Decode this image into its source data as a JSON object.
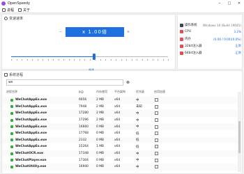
{
  "app": {
    "title": "OpenSpeedy"
  },
  "titlebar": {
    "minimize": "−",
    "maximize": "□",
    "close": "✕"
  },
  "menu": {
    "items": [
      "进程",
      "关于"
    ]
  },
  "speed": {
    "section_title": "变速速率",
    "display": "x 1.00倍",
    "minus": "−",
    "plus": "+",
    "value_label": "原速",
    "current": 1.0,
    "slider_fraction": 0.53
  },
  "hotkeys": [
    {
      "prefix": "Ctrl+Alt+",
      "key": "↑",
      "label": "增加速度"
    },
    {
      "prefix": "Ctrl+Alt+",
      "key": "↓",
      "label": "减少速度"
    },
    {
      "prefix": "Ctrl+Alt+",
      "key": "0",
      "label": "重置速度"
    }
  ],
  "system": {
    "rows": [
      {
        "label": "操作系统",
        "value": "Windows 10 (Build 19045)",
        "icon_color": "#444444"
      },
      {
        "label": "CPU",
        "value": "3.2%",
        "icon_color": "#e05050"
      },
      {
        "label": "内存",
        "value": "(0.00 / 0.00)(0.0%)",
        "icon_color": "#e05050"
      },
      {
        "label": "32bit注入器",
        "value": "正常",
        "icon_color": "#e05050"
      },
      {
        "label": "64bit注入器",
        "value": "正常",
        "icon_color": "#e05050"
      }
    ]
  },
  "process": {
    "section_title": "系统进程",
    "search_value": "we",
    "clear": "⊗",
    "columns": [
      "进程名称",
      "PID",
      "内存使用",
      "平台架构",
      "优先级",
      "启用加速"
    ],
    "rows": [
      {
        "name": "WeChatAppEx.exe",
        "pid": "6656",
        "mem": "2 MB",
        "arch": "x64",
        "priority": "中",
        "enabled": false
      },
      {
        "name": "WeChatAppEx.exe",
        "pid": "7948",
        "mem": "2 MB",
        "arch": "x64",
        "priority": "未知",
        "enabled": false
      },
      {
        "name": "WeChatAppEx.exe",
        "pid": "17280",
        "mem": "2 MB",
        "arch": "x64",
        "priority": "中",
        "enabled": false
      },
      {
        "name": "WeChatAppEx.exe",
        "pid": "17296",
        "mem": "2 MB",
        "arch": "x64",
        "priority": "中",
        "enabled": false
      },
      {
        "name": "WeChatAppEx.exe",
        "pid": "16660",
        "mem": "0 MB",
        "arch": "x64",
        "priority": "中",
        "enabled": false
      },
      {
        "name": "WeChatAppEx.exe",
        "pid": "17768",
        "mem": "0 MB",
        "arch": "x64",
        "priority": "低",
        "enabled": false
      },
      {
        "name": "WeChatAppEx.exe",
        "pid": "2332",
        "mem": "0 MB",
        "arch": "x64",
        "priority": "低",
        "enabled": false
      },
      {
        "name": "WeChatAppEx.exe",
        "pid": "15264",
        "mem": "1 MB",
        "arch": "x64",
        "priority": "低",
        "enabled": false
      },
      {
        "name": "WeChatOCR.exe",
        "pid": "17348",
        "mem": "0 MB",
        "arch": "x64",
        "priority": "中",
        "enabled": false
      },
      {
        "name": "WeChatPlayer.exe",
        "pid": "17304",
        "mem": "0 MB",
        "arch": "x64",
        "priority": "中",
        "enabled": false
      },
      {
        "name": "WeChatUtility.exe",
        "pid": "16940",
        "mem": "0 MB",
        "arch": "x64",
        "priority": "中",
        "enabled": false
      }
    ]
  }
}
